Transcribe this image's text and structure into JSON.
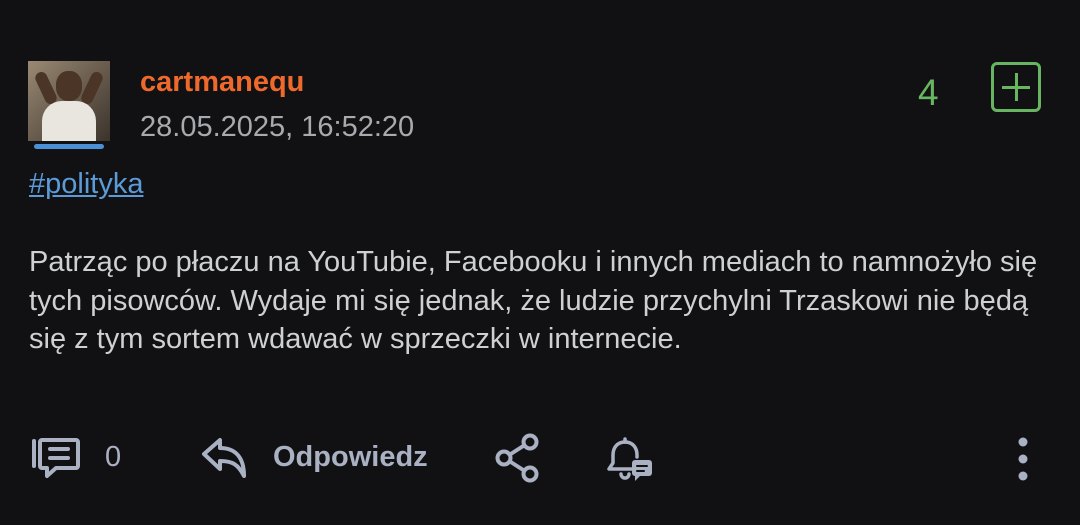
{
  "post": {
    "author": "cartmanequ",
    "timestamp": "28.05.2025, 16:52:20",
    "score": "4",
    "tag": "#polityka",
    "body": "Patrząc po płaczu na YouTubie, Facebooku i innych mediach to namnożyło się tych pisowców. Wydaje mi się jednak, że ludzie przychylni Trzaskowi nie będą się z tym sortem wdawać w sprzeczki w internecie."
  },
  "actions": {
    "comment_count": "0",
    "reply_label": "Odpowiedz"
  },
  "icons": [
    "avatar",
    "plus-icon",
    "comment-icon",
    "reply-icon",
    "share-icon",
    "bell-icon",
    "more-icon"
  ],
  "colors": {
    "background": "#111113",
    "username": "#ee6a2c",
    "score": "#68b561",
    "tag": "#5b9bd8",
    "text": "#cfd0d4",
    "muted": "#a9aab0"
  }
}
